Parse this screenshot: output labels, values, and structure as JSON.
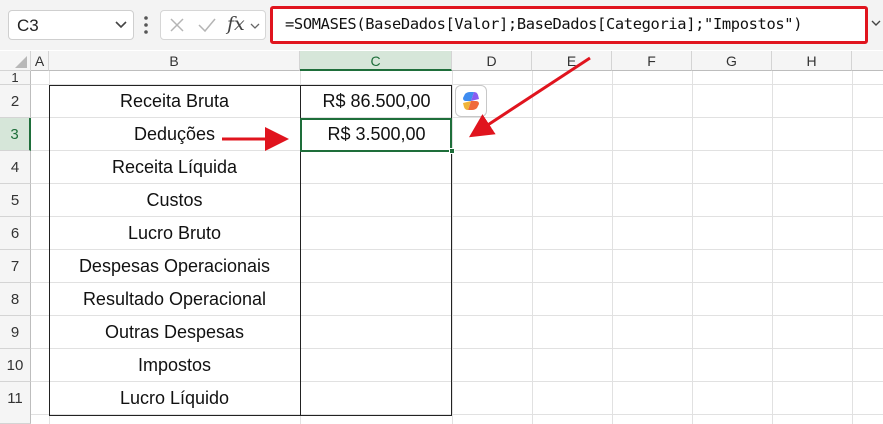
{
  "name_box": {
    "value": "C3"
  },
  "formula_bar": {
    "fx_label": "fx",
    "formula": "=SOMASES(BaseDados[Valor];BaseDados[Categoria];\"Impostos\")"
  },
  "columns": [
    "A",
    "B",
    "C",
    "D",
    "E",
    "F",
    "G",
    "H"
  ],
  "rows": [
    "1",
    "2",
    "3",
    "4",
    "5",
    "6",
    "7",
    "8",
    "9",
    "10",
    "11"
  ],
  "active": {
    "column": "C",
    "row": "3"
  },
  "table": {
    "labels": [
      "Receita Bruta",
      "Deduções",
      "Receita Líquida",
      "Custos",
      "Lucro Bruto",
      "Despesas Operacionais",
      "Resultado Operacional",
      "Outras Despesas",
      "Impostos",
      "Lucro Líquido"
    ],
    "values": [
      "R$ 86.500,00",
      "R$ 3.500,00",
      "",
      "",
      "",
      "",
      "",
      "",
      "",
      ""
    ]
  },
  "colors": {
    "highlight_red": "#e0141e",
    "excel_green": "#1e6e3a"
  },
  "icons": [
    "chevron-down-icon",
    "more-options-icon",
    "cancel-x-icon",
    "enter-check-icon",
    "insert-function-icon",
    "copilot-icon",
    "arrow-annotation-icon"
  ]
}
